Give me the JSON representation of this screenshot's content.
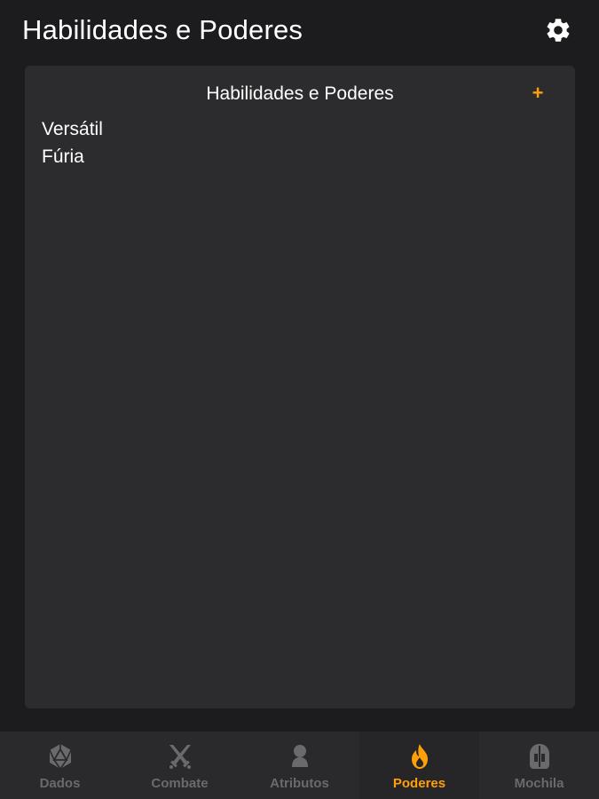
{
  "header": {
    "title": "Habilidades e Poderes",
    "settings_icon": "gear-icon"
  },
  "card": {
    "title": "Habilidades e Poderes",
    "add_label": "+",
    "items": [
      {
        "label": "Versátil"
      },
      {
        "label": "Fúria"
      }
    ]
  },
  "tabs": [
    {
      "label": "Dados",
      "icon": "d20-icon",
      "active": false
    },
    {
      "label": "Combate",
      "icon": "crossed-swords-icon",
      "active": false
    },
    {
      "label": "Atributos",
      "icon": "person-icon",
      "active": false
    },
    {
      "label": "Poderes",
      "icon": "flame-icon",
      "active": true
    },
    {
      "label": "Mochila",
      "icon": "helmet-icon",
      "active": false
    }
  ],
  "colors": {
    "accent": "#ff9f0a",
    "background": "#1c1c1e",
    "card": "#2c2c2e",
    "tabbar": "#2a2a2c",
    "inactive": "#6a6a6e"
  }
}
